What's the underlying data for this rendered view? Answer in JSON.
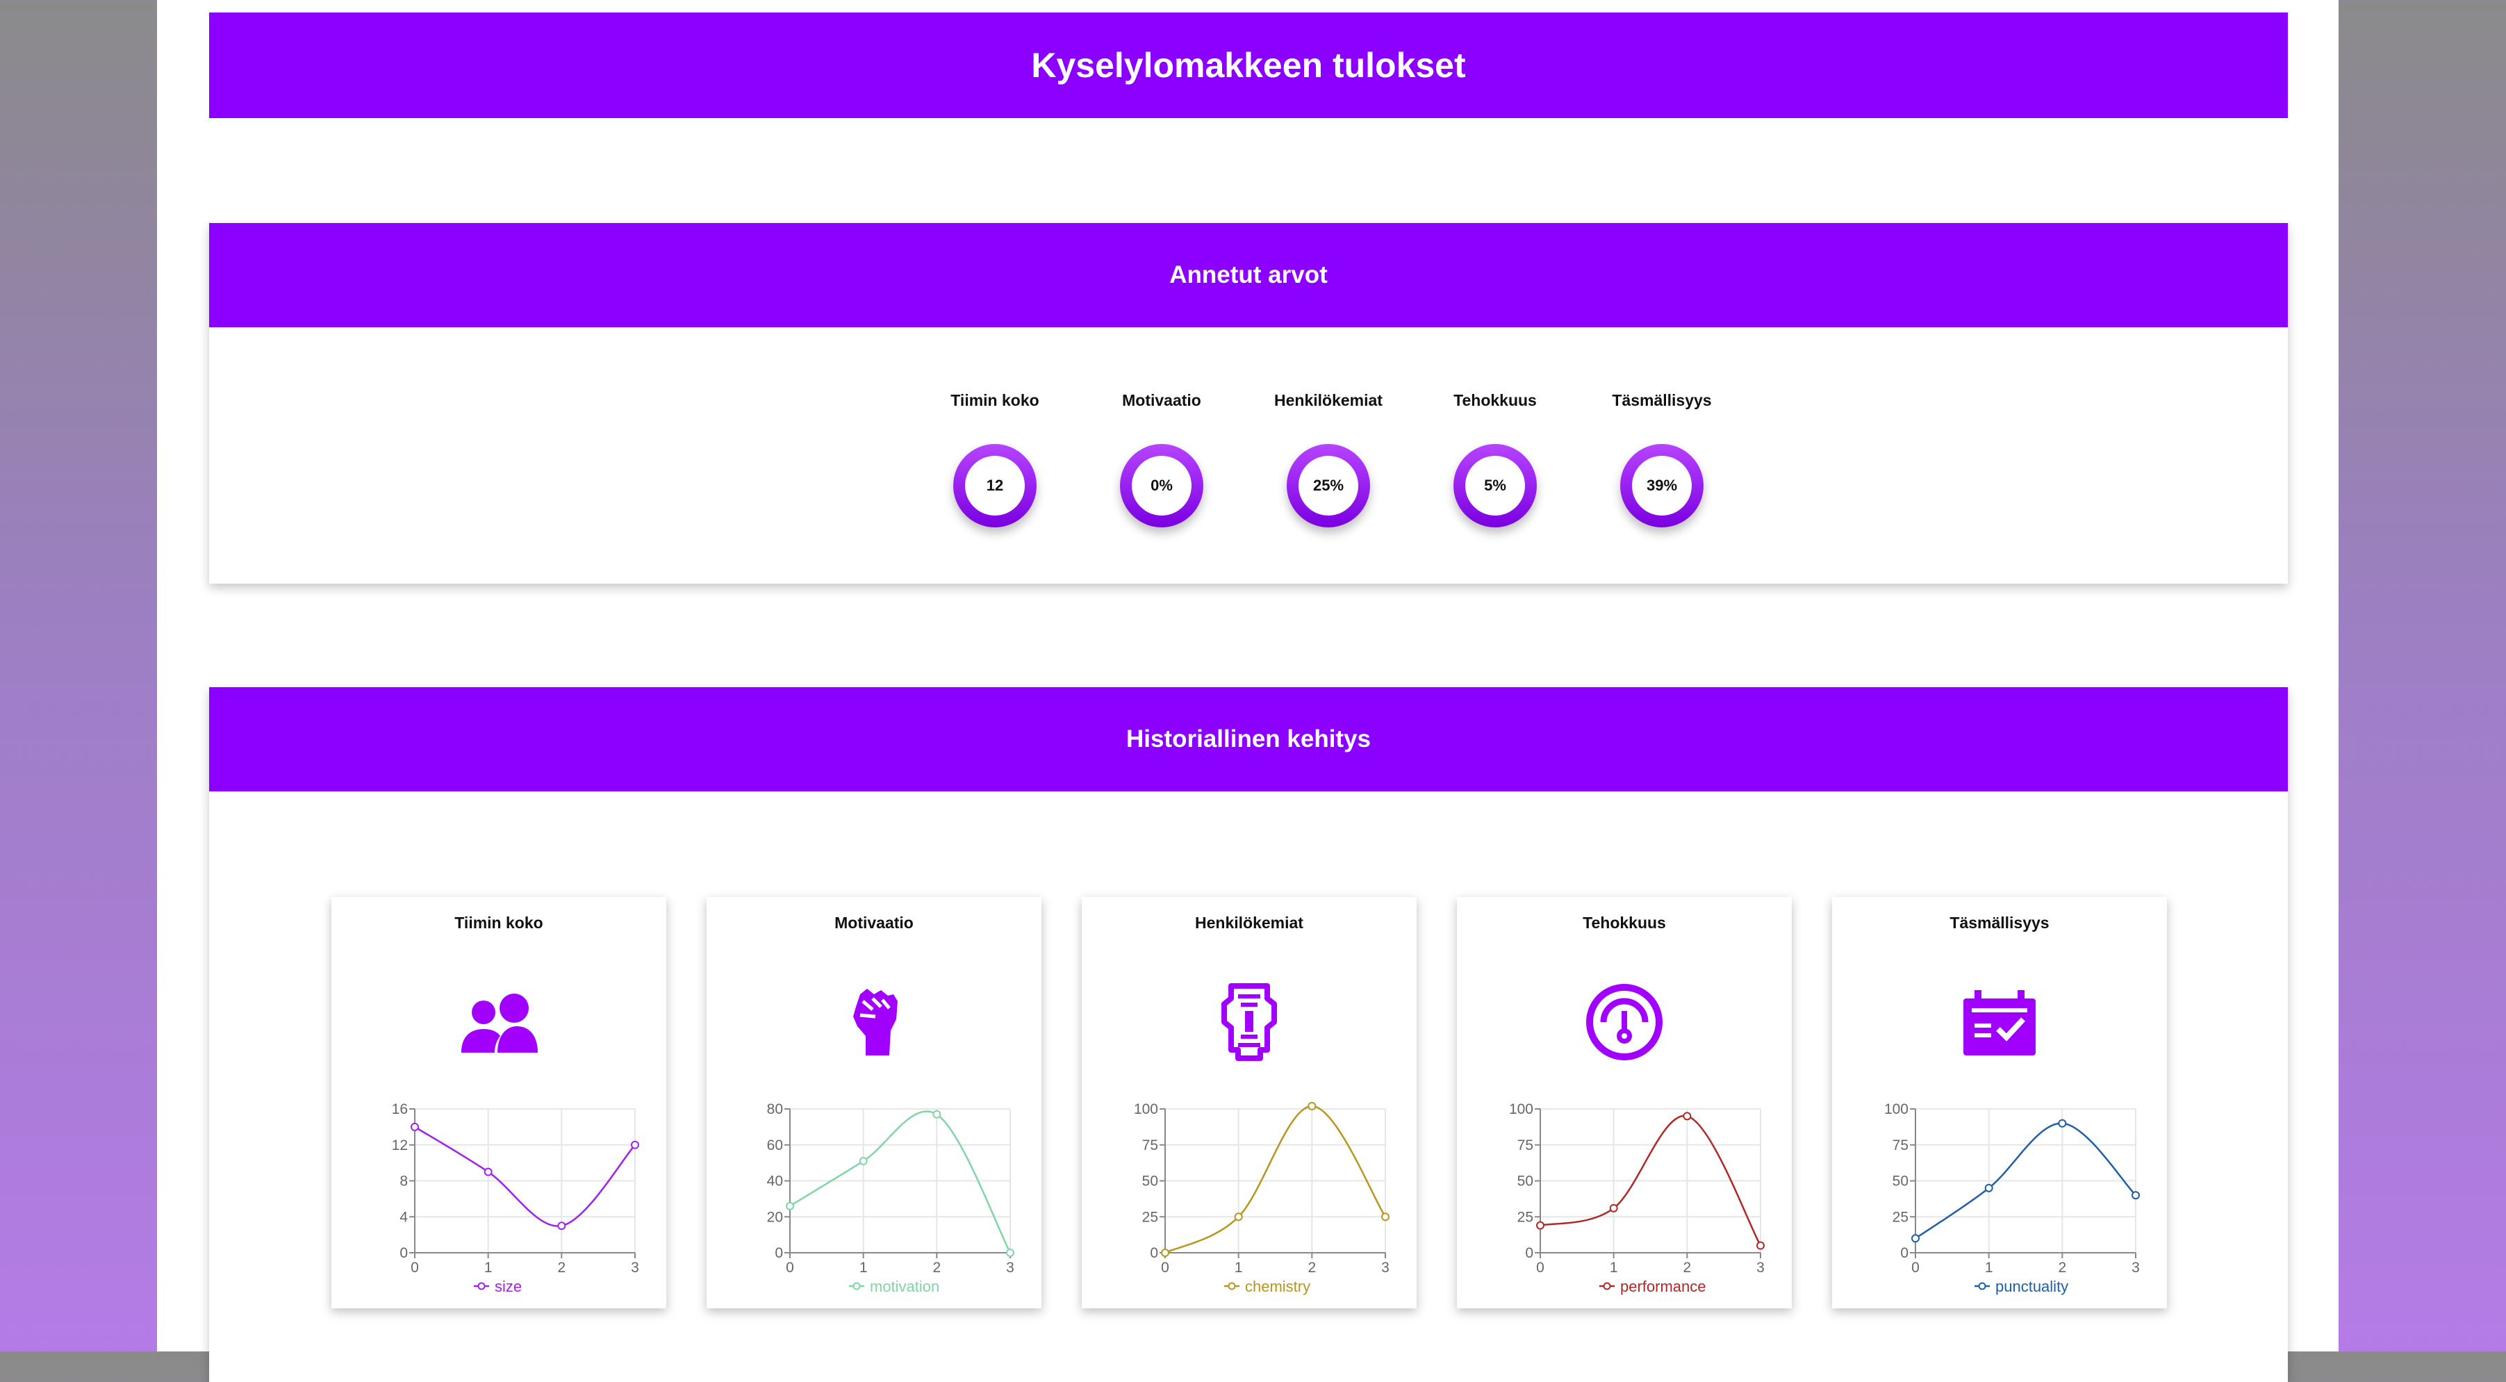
{
  "header": {
    "title": "Kyselylomakkeen tulokset"
  },
  "values_section": {
    "title": "Annetut arvot",
    "items": [
      {
        "label": "Tiimin koko",
        "value": "12"
      },
      {
        "label": "Motivaatio",
        "value": "0%"
      },
      {
        "label": "Henkilökemiat",
        "value": "25%"
      },
      {
        "label": "Tehokkuus",
        "value": "5%"
      },
      {
        "label": "Täsmällisyys",
        "value": "39%"
      }
    ]
  },
  "history_section": {
    "title": "Historiallinen kehitys"
  },
  "colors": {
    "accent": "#8c00ff"
  },
  "chart_data": [
    {
      "type": "line",
      "title": "Tiimin koko",
      "icon": "team-icon",
      "x": [
        0,
        1,
        2,
        3
      ],
      "ylim": [
        0,
        16
      ],
      "yticks": [
        0,
        4,
        8,
        12,
        16
      ],
      "series": [
        {
          "name": "size",
          "values": [
            14,
            9,
            3,
            12
          ],
          "color": "#a020f0"
        }
      ]
    },
    {
      "type": "line",
      "title": "Motivaatio",
      "icon": "raised-fist-icon",
      "x": [
        0,
        1,
        2,
        3
      ],
      "ylim": [
        0,
        80
      ],
      "yticks": [
        0,
        20,
        40,
        60,
        80
      ],
      "series": [
        {
          "name": "motivation",
          "values": [
            26,
            51,
            77,
            0
          ],
          "color": "#7fd6a4"
        }
      ]
    },
    {
      "type": "line",
      "title": "Henkilökemiat",
      "icon": "chemistry-icon",
      "x": [
        0,
        1,
        2,
        3
      ],
      "ylim": [
        0,
        100
      ],
      "yticks": [
        0,
        25,
        50,
        75,
        100
      ],
      "series": [
        {
          "name": "chemistry",
          "values": [
            0,
            25,
            102,
            25
          ],
          "color": "#b8961e"
        }
      ]
    },
    {
      "type": "line",
      "title": "Tehokkuus",
      "icon": "gauge-icon",
      "x": [
        0,
        1,
        2,
        3
      ],
      "ylim": [
        0,
        100
      ],
      "yticks": [
        0,
        25,
        50,
        75,
        100
      ],
      "series": [
        {
          "name": "performance",
          "values": [
            19,
            31,
            95,
            5
          ],
          "color": "#b02828"
        }
      ]
    },
    {
      "type": "line",
      "title": "Täsmällisyys",
      "icon": "calendar-check-icon",
      "x": [
        0,
        1,
        2,
        3
      ],
      "ylim": [
        0,
        100
      ],
      "yticks": [
        0,
        25,
        50,
        75,
        100
      ],
      "series": [
        {
          "name": "punctuality",
          "values": [
            10,
            45,
            90,
            40
          ],
          "color": "#1f5fa8"
        }
      ]
    }
  ]
}
